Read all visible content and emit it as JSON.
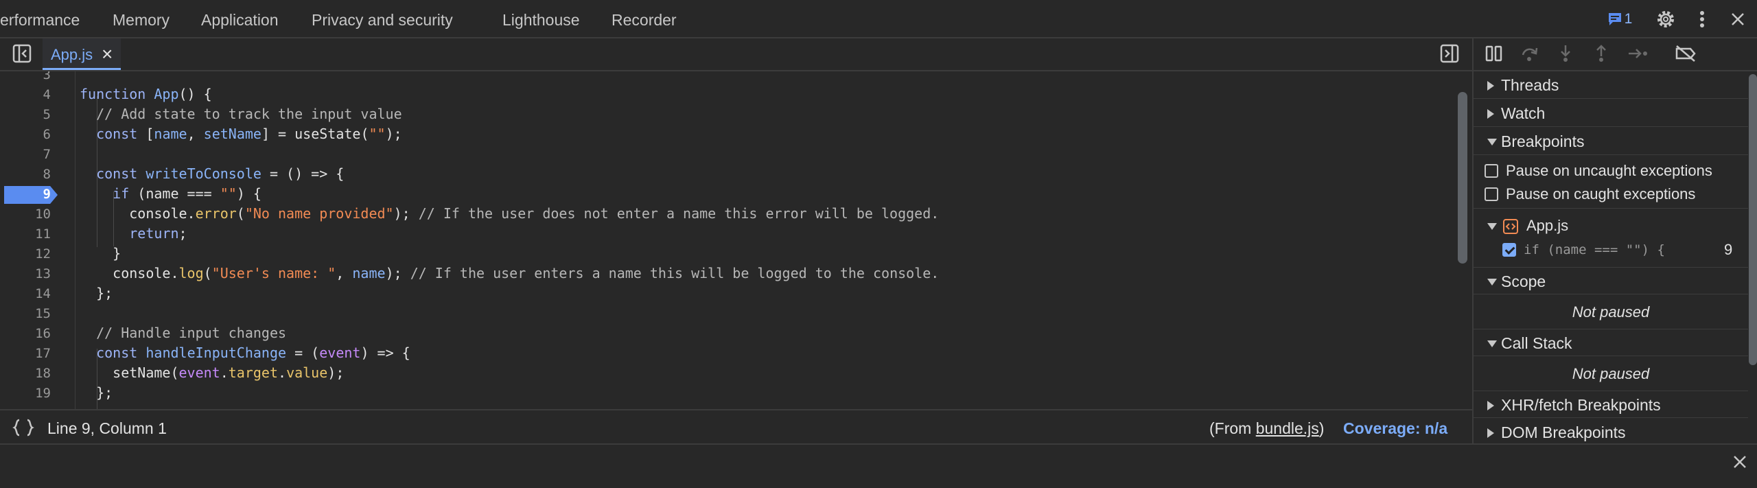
{
  "top_tabs": [
    "erformance",
    "Memory",
    "Application",
    "Privacy and security",
    "Lighthouse",
    "Recorder"
  ],
  "issues_badge": {
    "icon": "message-icon",
    "count": "1"
  },
  "file_tab": {
    "name": "App.js",
    "close": "×"
  },
  "code_lines": [
    {
      "n": "3",
      "code": ""
    },
    {
      "n": "4",
      "code": "function App() {"
    },
    {
      "n": "5",
      "code": "  // Add state to track the input value"
    },
    {
      "n": "6",
      "code": "  const [name, setName] = useState(\"\");"
    },
    {
      "n": "7",
      "code": ""
    },
    {
      "n": "8",
      "code": "  const writeToConsole = () => {"
    },
    {
      "n": "9",
      "code": "    if (name === \"\") {"
    },
    {
      "n": "10",
      "code": "      console.error(\"No name provided\"); // If the user does not enter a name this error will be logged."
    },
    {
      "n": "11",
      "code": "      return;"
    },
    {
      "n": "12",
      "code": "    }"
    },
    {
      "n": "13",
      "code": "    console.log(\"User's name: \", name); // If the user enters a name this will be logged to the console."
    },
    {
      "n": "14",
      "code": "  };"
    },
    {
      "n": "15",
      "code": ""
    },
    {
      "n": "16",
      "code": "  // Handle input changes"
    },
    {
      "n": "17",
      "code": "  const handleInputChange = (event) => {"
    },
    {
      "n": "18",
      "code": "    setName(event.target.value);"
    },
    {
      "n": "19",
      "code": "  };"
    }
  ],
  "active_line": "9",
  "status": {
    "position": "Line 9, Column 1",
    "from_prefix": "(From ",
    "from_file": "bundle.js",
    "from_suffix": ")",
    "coverage": "Coverage: n/a"
  },
  "sidebar": {
    "threads": "Threads",
    "watch": "Watch",
    "breakpoints": "Breakpoints",
    "pause_uncaught": "Pause on uncaught exceptions",
    "pause_caught": "Pause on caught exceptions",
    "bp_file": "App.js",
    "bp_code": "if (name === \"\") {",
    "bp_line": "9",
    "scope": "Scope",
    "scope_state": "Not paused",
    "call_stack": "Call Stack",
    "call_stack_state": "Not paused",
    "xhr": "XHR/fetch Breakpoints",
    "dom": "DOM Breakpoints"
  },
  "colors": {
    "accent": "#7cacf8",
    "breakpoint": "#5a8cf0",
    "background": "#282828"
  }
}
